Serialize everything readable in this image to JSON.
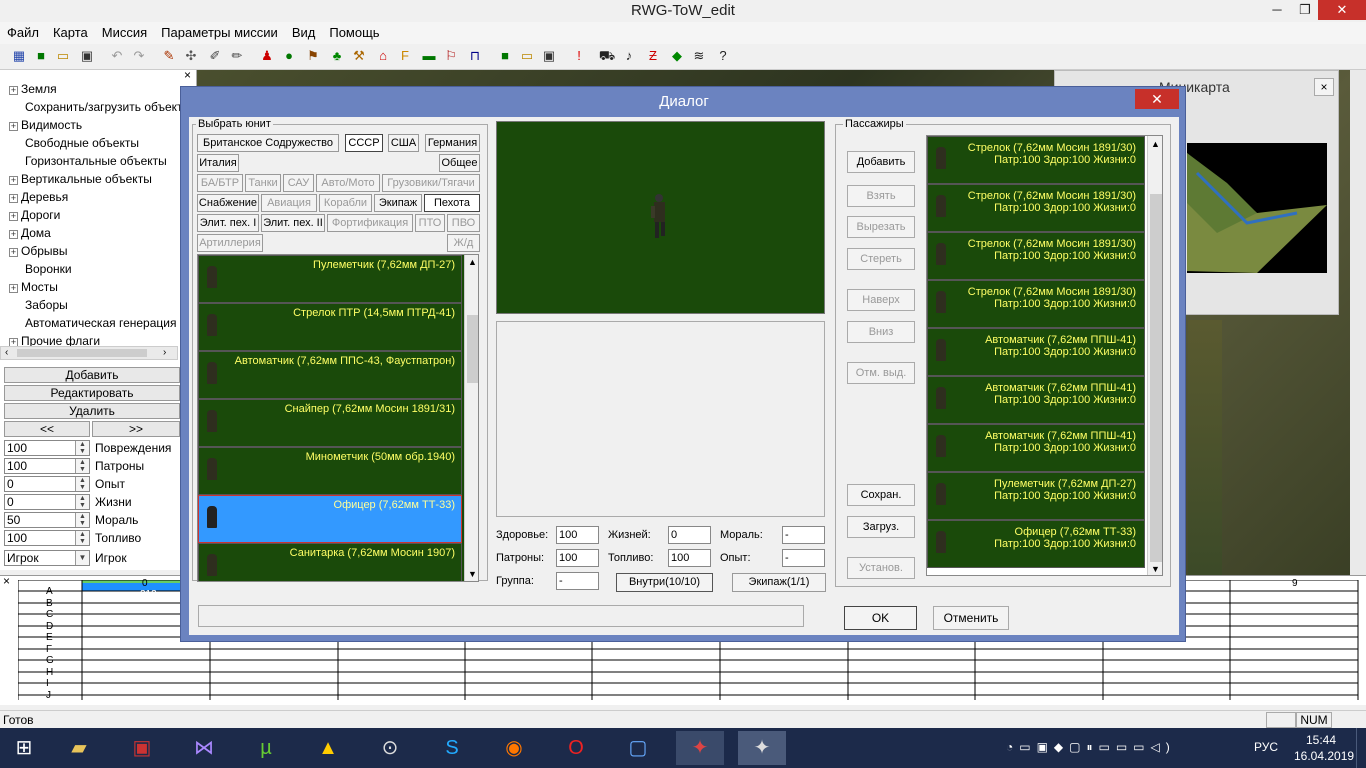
{
  "window": {
    "title": "RWG-ToW_edit",
    "min": "─",
    "max": "❐",
    "close": "✕"
  },
  "menu": [
    "Файл",
    "Карта",
    "Миссия",
    "Параметры миссии",
    "Вид",
    "Помощь"
  ],
  "tree": [
    {
      "label": "Земля",
      "plus": true
    },
    {
      "label": "Сохранить/загрузить объект",
      "plus": false
    },
    {
      "label": "Видимость",
      "plus": true
    },
    {
      "label": "Свободные объекты",
      "plus": false
    },
    {
      "label": "Горизонтальные объекты",
      "plus": false
    },
    {
      "label": "Вертикальные объекты",
      "plus": true
    },
    {
      "label": "Деревья",
      "plus": true
    },
    {
      "label": "Дороги",
      "plus": true
    },
    {
      "label": "Дома",
      "plus": true
    },
    {
      "label": "Обрывы",
      "plus": true
    },
    {
      "label": "Воронки",
      "plus": false
    },
    {
      "label": "Мосты",
      "plus": true
    },
    {
      "label": "Заборы",
      "plus": false
    },
    {
      "label": "Автоматическая генерация",
      "plus": false
    },
    {
      "label": "Прочие флаги",
      "plus": true
    }
  ],
  "left_buttons": {
    "add": "Добавить",
    "edit": "Редактировать",
    "delete": "Удалить",
    "prev": "<<",
    "next": ">>"
  },
  "params": [
    {
      "value": "100",
      "label": "Повреждения"
    },
    {
      "value": "100",
      "label": "Патроны"
    },
    {
      "value": "0",
      "label": "Опыт"
    },
    {
      "value": "0",
      "label": "Жизни"
    },
    {
      "value": "50",
      "label": "Мораль"
    },
    {
      "value": "100",
      "label": "Топливо"
    }
  ],
  "player": {
    "value": "Игрок",
    "label": "Игрок"
  },
  "minimap": {
    "title": "Миникарта",
    "close": "×"
  },
  "grid": {
    "rows": [
      "A",
      "B",
      "C",
      "D",
      "E",
      "F",
      "G",
      "H",
      "I",
      "J"
    ],
    "col0": "0",
    "col9": "9",
    "a_value": "213"
  },
  "status": {
    "text": "Готов",
    "num": "NUM"
  },
  "taskbar": {
    "lang": "РУС",
    "time": "15:44",
    "date": "16.04.2019"
  },
  "dialog": {
    "title": "Диалог",
    "close": "✕",
    "select_unit_label": "Выбрать юнит",
    "nations": [
      "Британское Содружество",
      "СССР",
      "США",
      "Германия",
      "Италия",
      "Общее"
    ],
    "categories": [
      {
        "label": "БА/БТР",
        "dis": true
      },
      {
        "label": "Танки",
        "dis": true
      },
      {
        "label": "САУ",
        "dis": true
      },
      {
        "label": "Авто/Мото",
        "dis": true
      },
      {
        "label": "Грузовики/Тягачи",
        "dis": true
      },
      {
        "label": "Снабжение",
        "dis": false
      },
      {
        "label": "Авиация",
        "dis": true
      },
      {
        "label": "Корабли",
        "dis": true
      },
      {
        "label": "Экипаж",
        "dis": false
      },
      {
        "label": "Пехота",
        "dis": false
      },
      {
        "label": "Элит. пех. I",
        "dis": false
      },
      {
        "label": "Элит. пех. II",
        "dis": false
      },
      {
        "label": "Фортификация",
        "dis": true
      },
      {
        "label": "ПТО",
        "dis": true
      },
      {
        "label": "ПВО",
        "dis": true
      },
      {
        "label": "Артиллерия",
        "dis": true
      },
      {
        "label": "Ж/д",
        "dis": true
      }
    ],
    "units": [
      "Пулеметчик (7,62мм ДП-27)",
      "Стрелок ПТР (14,5мм ПТРД-41)",
      "Автоматчик (7,62мм ППС-43, Фаустпатрон)",
      "Снайпер (7,62мм Мосин 1891/31)",
      "Минометчик (50мм обр.1940)",
      "Офицер (7,62мм ТТ-33)",
      "Санитарка (7,62мм Мосин 1907)"
    ],
    "fields": {
      "health_label": "Здоровье:",
      "health": "100",
      "lives_label": "Жизней:",
      "lives": "0",
      "morale_label": "Мораль:",
      "morale": "-",
      "ammo_label": "Патроны:",
      "ammo": "100",
      "fuel_label": "Топливо:",
      "fuel": "100",
      "exp_label": "Опыт:",
      "exp": "-",
      "group_label": "Группа:",
      "group": "-"
    },
    "inside_btn": "Внутри(10/10)",
    "crew_btn": "Экипаж(1/1)",
    "passengers_label": "Пассажиры",
    "side_buttons": [
      {
        "label": "Добавить",
        "dis": false
      },
      {
        "label": "Взять",
        "dis": true
      },
      {
        "label": "Вырезать",
        "dis": true
      },
      {
        "label": "Стереть",
        "dis": true
      },
      {
        "label": "Наверх",
        "dis": true
      },
      {
        "label": "Вниз",
        "dis": true
      },
      {
        "label": "Отм. выд.",
        "dis": true
      },
      {
        "label": "Сохран.",
        "dis": false
      },
      {
        "label": "Загруз.",
        "dis": false
      },
      {
        "label": "Установ.",
        "dis": true
      }
    ],
    "passengers": [
      {
        "name": "Стрелок (7,62мм Мосин 1891/30)",
        "stats": "Патр:100 Здор:100 Жизни:0"
      },
      {
        "name": "Стрелок (7,62мм Мосин 1891/30)",
        "stats": "Патр:100 Здор:100 Жизни:0"
      },
      {
        "name": "Стрелок (7,62мм Мосин 1891/30)",
        "stats": "Патр:100 Здор:100 Жизни:0"
      },
      {
        "name": "Стрелок (7,62мм Мосин 1891/30)",
        "stats": "Патр:100 Здор:100 Жизни:0"
      },
      {
        "name": "Автоматчик (7,62мм ППШ-41)",
        "stats": "Патр:100 Здор:100 Жизни:0"
      },
      {
        "name": "Автоматчик (7,62мм ППШ-41)",
        "stats": "Патр:100 Здор:100 Жизни:0"
      },
      {
        "name": "Автоматчик (7,62мм ППШ-41)",
        "stats": "Патр:100 Здор:100 Жизни:0"
      },
      {
        "name": "Пулеметчик (7,62мм ДП-27)",
        "stats": "Патр:100 Здор:100 Жизни:0"
      },
      {
        "name": "Офицер (7,62мм ТТ-33)",
        "stats": "Патр:100 Здор:100 Жизни:0"
      }
    ],
    "ok": "OK",
    "cancel": "Отменить"
  }
}
